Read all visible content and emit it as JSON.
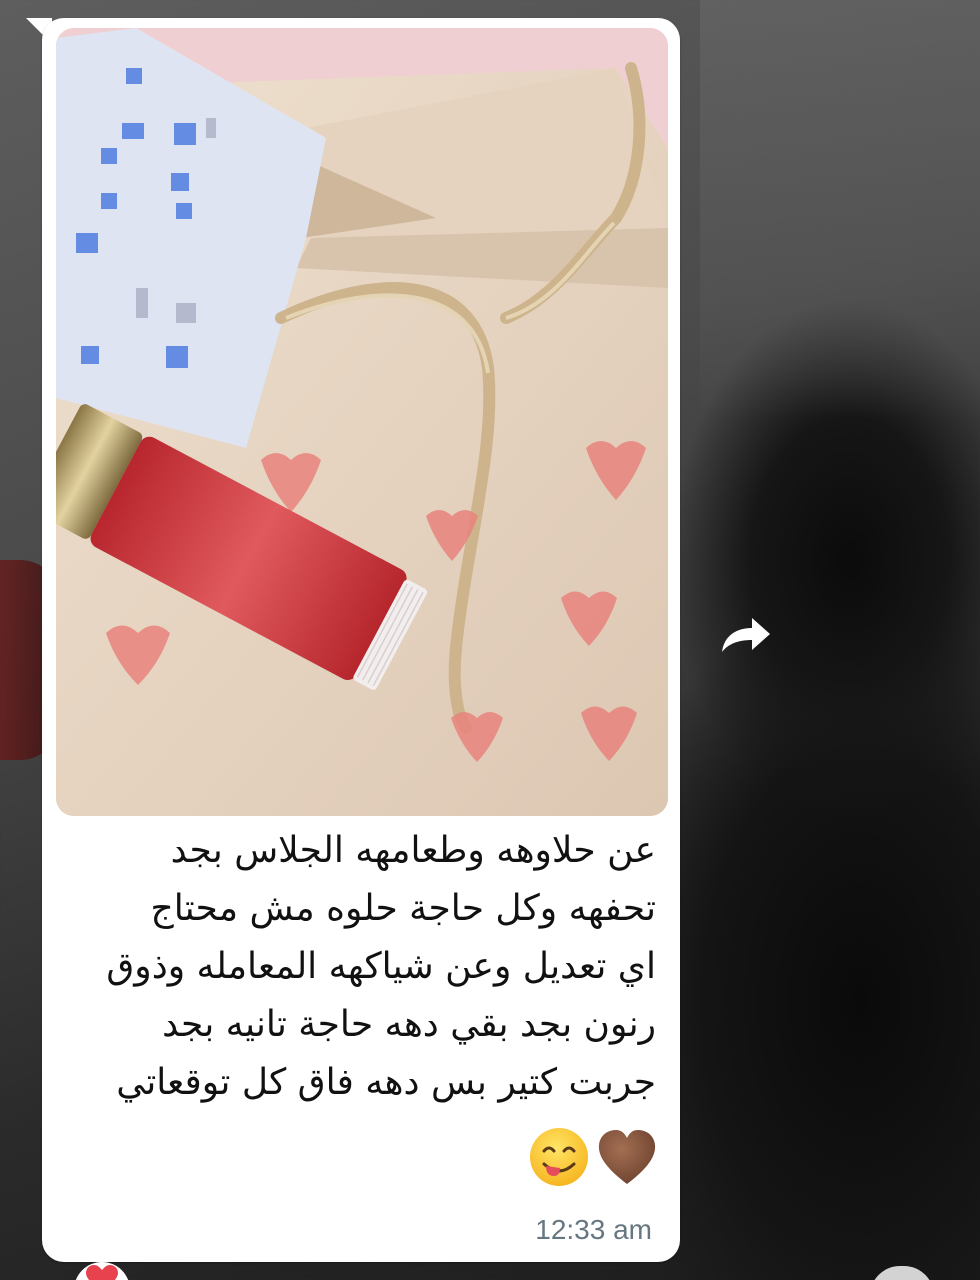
{
  "message": {
    "caption_lines": [
      "عن حلاوهه وطعامهه الجلاس بجد",
      "تحفهه وكل حاجة حلوه مش محتاج",
      "اي تعديل وعن شياكهه المعامله وذوق",
      "رنون بجد بقي دهه حاجة تانيه بجد",
      "جربت كتير بس دهه فاق كل توقعاتي"
    ],
    "emojis": [
      "brown-heart-emoji",
      "savoring-food-face-emoji"
    ],
    "timestamp": "12:33 am"
  },
  "icons": {
    "forward": "forward-arrow-icon",
    "reaction": "red-heart-reaction-icon"
  },
  "colors": {
    "bubble": "#ffffff",
    "timestamp": "#667781",
    "lipgloss": "#c8373d",
    "heart_print": "#e8837d"
  }
}
